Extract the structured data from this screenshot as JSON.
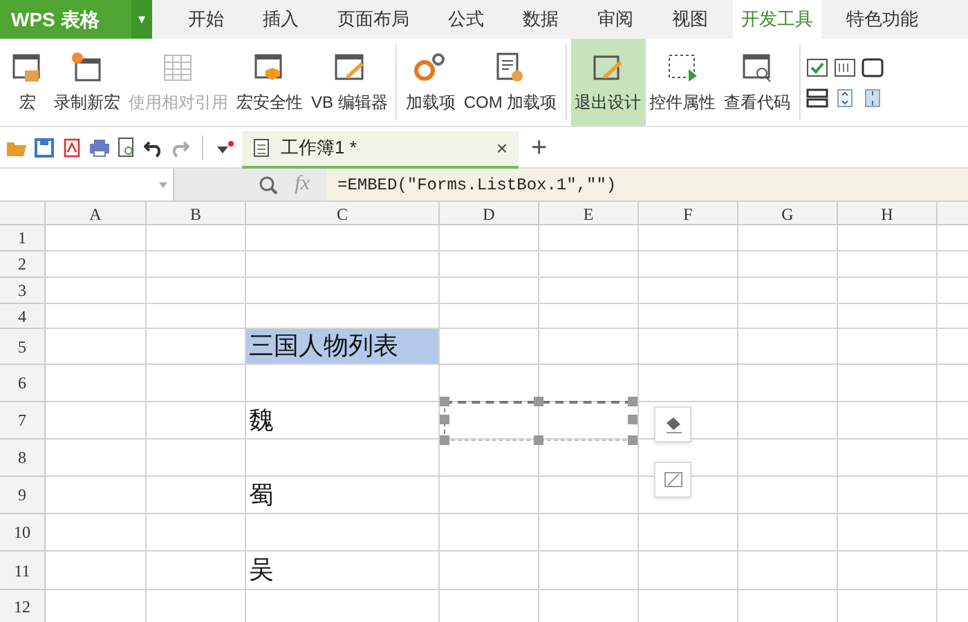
{
  "app": {
    "logo": "WPS 表格",
    "menu_arrow": "▾"
  },
  "tabs": [
    {
      "label": "开始",
      "selected": false
    },
    {
      "label": "插入",
      "selected": false
    },
    {
      "label": "页面布局",
      "selected": false
    },
    {
      "label": "公式",
      "selected": false
    },
    {
      "label": "数据",
      "selected": false
    },
    {
      "label": "审阅",
      "selected": false
    },
    {
      "label": "视图",
      "selected": false
    },
    {
      "label": "开发工具",
      "selected": true
    },
    {
      "label": "特色功能",
      "selected": false
    }
  ],
  "ribbon": [
    {
      "label": "宏",
      "kind": "macro",
      "disabled": false,
      "selected": false
    },
    {
      "label": "录制新宏",
      "kind": "record",
      "disabled": false,
      "selected": false
    },
    {
      "label": "使用相对引用",
      "kind": "relative",
      "disabled": true,
      "selected": false
    },
    {
      "label": "宏安全性",
      "kind": "security",
      "disabled": false,
      "selected": false
    },
    {
      "label": "VB 编辑器",
      "kind": "editor",
      "disabled": false,
      "selected": false
    },
    {
      "label": "加载项",
      "kind": "addin",
      "disabled": false,
      "selected": false
    },
    {
      "label": "COM 加载项",
      "kind": "com",
      "disabled": false,
      "selected": false
    },
    {
      "label": "退出设计",
      "kind": "design",
      "disabled": false,
      "selected": true
    },
    {
      "label": "控件属性",
      "kind": "props",
      "disabled": false,
      "selected": false
    },
    {
      "label": "查看代码",
      "kind": "code",
      "disabled": false,
      "selected": false
    }
  ],
  "document_tab": {
    "title": "工作簿1 *",
    "close": "×",
    "new": "+"
  },
  "formula_bar": {
    "fx": "fx",
    "formula": "=EMBED(\"Forms.ListBox.1\",\"\")"
  },
  "columns": [
    "A",
    "B",
    "C",
    "D",
    "E",
    "F",
    "G",
    "H"
  ],
  "rows": [
    {
      "header": "1"
    },
    {
      "header": "2"
    },
    {
      "header": "3"
    },
    {
      "header": "4"
    },
    {
      "header": "5",
      "column_c": {
        "text": "三国人物列表",
        "selected": true
      }
    },
    {
      "header": "6"
    },
    {
      "header": "7",
      "column_c": {
        "text": "魏",
        "selected": false
      }
    },
    {
      "header": "8"
    },
    {
      "header": "9",
      "column_c": {
        "text": "蜀",
        "selected": false
      }
    },
    {
      "header": "10"
    },
    {
      "header": "11",
      "column_c": {
        "text": "吴",
        "selected": false
      }
    },
    {
      "header": "12"
    }
  ]
}
